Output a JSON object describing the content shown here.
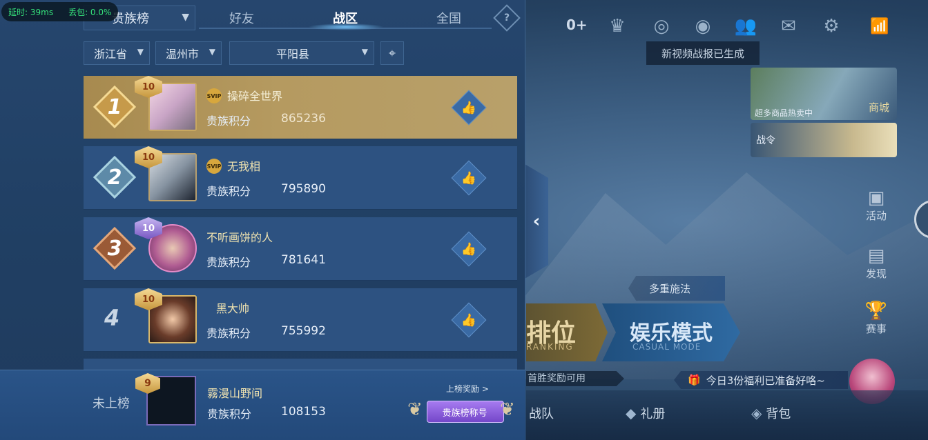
{
  "status": {
    "latency": "延时: 39ms",
    "packet_loss": "丢包: 0.0%"
  },
  "board": {
    "selector": "贵族榜",
    "tabs": [
      "好友",
      "战区",
      "全国"
    ],
    "active_tab_index": 1,
    "filters": {
      "province": "浙江省",
      "city": "温州市",
      "county": "平阳县"
    }
  },
  "rows": [
    {
      "rank": "1",
      "vip": "10",
      "svip": "SVIP",
      "name": "操碎全世界",
      "label": "贵族积分",
      "score": "865236"
    },
    {
      "rank": "2",
      "vip": "10",
      "svip": "SVIP",
      "name": "无我相",
      "label": "贵族积分",
      "score": "795890"
    },
    {
      "rank": "3",
      "vip": "10",
      "name": "不听画饼的人",
      "label": "贵族积分",
      "score": "781641"
    },
    {
      "rank": "4",
      "vip": "10",
      "name": "黑大帅",
      "label": "贵族积分",
      "score": "755992"
    }
  ],
  "self": {
    "status": "未上榜",
    "vip": "9",
    "name": "霧漫山野间",
    "label": "贵族积分",
    "score": "108153",
    "reward_link": "上榜奖励 >",
    "title_button": "贵族榜称号"
  },
  "lobby": {
    "plus_count": "0+",
    "video_tip": "新视频战报已生成",
    "shop_caption": "超多商品热卖中",
    "shop_label": "商城",
    "pass_label": "战令",
    "side": [
      {
        "icon": "camera-icon",
        "label": "活动"
      },
      {
        "icon": "notebook-icon",
        "label": "发现"
      },
      {
        "icon": "trophy-icon",
        "label": "赛事"
      }
    ],
    "multicast": "多重施法",
    "ranked": "排位",
    "ranked_sub": "RANKING",
    "casual": "娱乐模式",
    "casual_sub": "CASUAL MODE",
    "win_bar": "首胜奖励可用",
    "welfare": "今日3份福利已准备好咯~",
    "nav": [
      "战队",
      "礼册",
      "背包"
    ]
  },
  "colors": {
    "gold_row": "#b59a60",
    "panel": "#23426a",
    "accent_tab": "#78c8ff"
  }
}
